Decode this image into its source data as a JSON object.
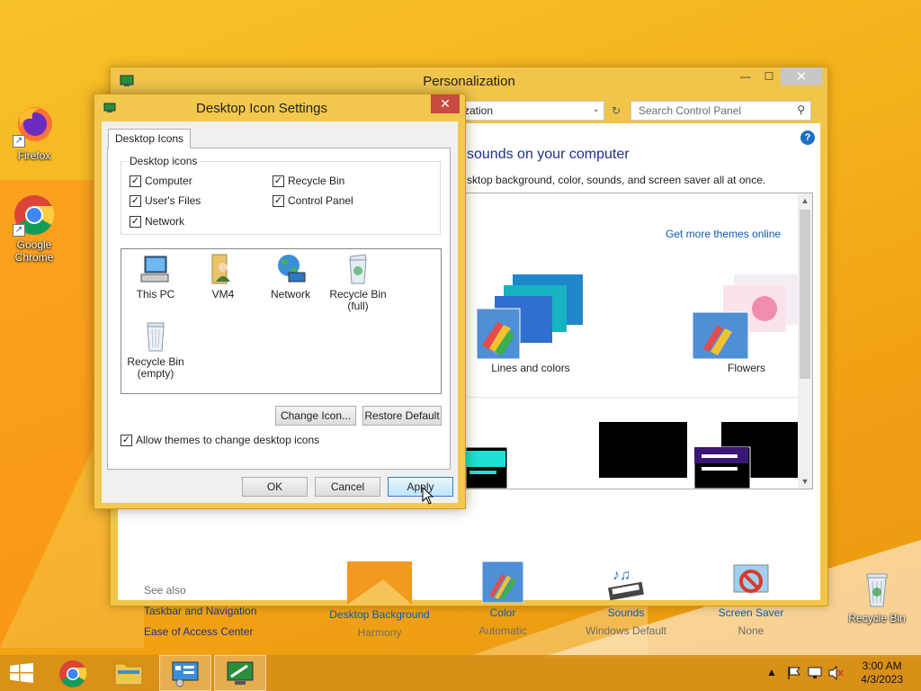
{
  "desktop": {
    "icons": [
      {
        "label": "Firefox",
        "icon": "firefox-icon"
      },
      {
        "label": "Google Chrome",
        "icon": "chrome-icon"
      },
      {
        "label": "Recycle Bin",
        "icon": "recycle-bin-icon"
      }
    ]
  },
  "personalization": {
    "title": "Personalization",
    "address_fragment": "zation",
    "search_placeholder": "Search Control Panel",
    "heading": "sounds on your computer",
    "subtext": "sktop background, color, sounds, and screen saver all at once.",
    "themes_link": "Get more themes online",
    "themes": [
      {
        "label": "Lines and colors"
      },
      {
        "label": "Flowers"
      }
    ],
    "see_also": {
      "title": "See also",
      "links": [
        "Taskbar and Navigation",
        "Ease of Access Center"
      ]
    },
    "bottom_items": [
      {
        "label": "Desktop Background",
        "value": "Harmony",
        "icon": "desktop-background-icon"
      },
      {
        "label": "Color",
        "value": "Automatic",
        "icon": "color-palette-icon"
      },
      {
        "label": "Sounds",
        "value": "Windows Default",
        "icon": "sounds-icon"
      },
      {
        "label": "Screen Saver",
        "value": "None",
        "icon": "screen-saver-icon"
      }
    ]
  },
  "dialog": {
    "title": "Desktop Icon Settings",
    "tab_label": "Desktop Icons",
    "group_title": "Desktop icons",
    "checkboxes": [
      {
        "label": "Computer",
        "checked": true
      },
      {
        "label": "Recycle Bin",
        "checked": true
      },
      {
        "label": "User's Files",
        "checked": true
      },
      {
        "label": "Control Panel",
        "checked": true
      },
      {
        "label": "Network",
        "checked": true
      }
    ],
    "icon_items": [
      {
        "label": "This PC",
        "icon": "this-pc-icon"
      },
      {
        "label": "VM4",
        "icon": "user-folder-icon"
      },
      {
        "label": "Network",
        "icon": "network-globe-icon"
      },
      {
        "label": "Recycle Bin (full)",
        "icon": "recycle-bin-full-icon"
      },
      {
        "label": "Recycle Bin (empty)",
        "icon": "recycle-bin-empty-icon"
      }
    ],
    "change_icon_label": "Change Icon...",
    "restore_default_label": "Restore Default",
    "allow_themes_label": "Allow themes to change desktop icons",
    "allow_themes_checked": true,
    "ok_label": "OK",
    "cancel_label": "Cancel",
    "apply_label": "Apply"
  },
  "taskbar": {
    "time": "3:00 AM",
    "date": "4/3/2023",
    "buttons": [
      "start-button",
      "chrome-taskbar",
      "file-explorer-taskbar",
      "control-panel-taskbar",
      "personalization-taskbar"
    ]
  },
  "colors": {
    "accent": "#f3c84e",
    "close_red": "#c74b40",
    "link_blue": "#0a5bb8",
    "heading_blue": "#1e3287",
    "taskbar": "#d68e18"
  }
}
